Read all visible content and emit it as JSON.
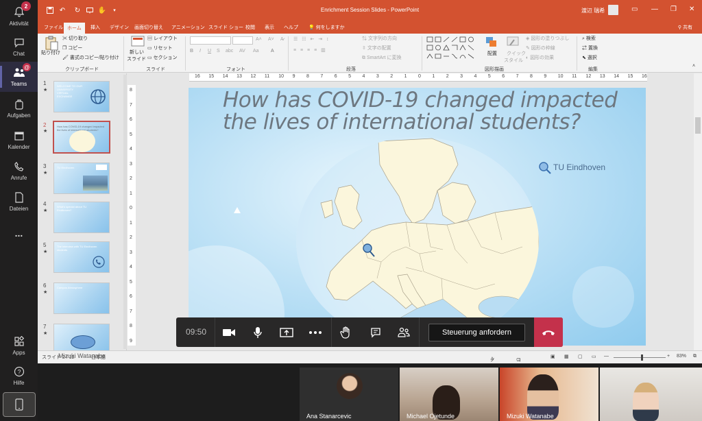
{
  "rail": {
    "items": [
      {
        "label": "Aktivität",
        "badge": "2"
      },
      {
        "label": "Chat"
      },
      {
        "label": "Teams",
        "badge": "@"
      },
      {
        "label": "Aufgaben"
      },
      {
        "label": "Kalender"
      },
      {
        "label": "Anrufe"
      },
      {
        "label": "Dateien"
      },
      {
        "label": "..."
      },
      {
        "label": "Apps"
      },
      {
        "label": "Hilfe"
      }
    ]
  },
  "ppt": {
    "window_title": "Enrichment Session Slides  -  PowerPoint",
    "user": "渡辺 瑞希",
    "tabs": [
      "ファイル",
      "ホーム",
      "挿入",
      "デザイン",
      "画面切り替え",
      "アニメーション",
      "スライド ショー",
      "校閲",
      "表示",
      "ヘルプ",
      "何をしますか"
    ],
    "share": "共有",
    "ribbon": {
      "clipboard": {
        "paste": "貼り付け",
        "cut": "切り取り",
        "copy": "コピー",
        "format_painter": "書式のコピー/貼り付け",
        "group": "クリップボード"
      },
      "slides": {
        "new": "新しい",
        "new2": "スライド",
        "layout": "レイアウト",
        "reset": "リセット",
        "section": "セクション",
        "group": "スライド"
      },
      "font": {
        "group": "フォント"
      },
      "paragraph": {
        "dir": "文字列の方向",
        "align": "文字の配置",
        "smartart": "SmartArt に変換",
        "group": "段落"
      },
      "drawing": {
        "arrange": "配置",
        "quick_style": "クイック",
        "quick_style2": "スタイル",
        "fill": "図形の塗りつぶし",
        "outline": "図形の枠線",
        "effects": "図形の効果",
        "group": "図形描画"
      },
      "editing": {
        "find": "検索",
        "replace": "置換",
        "select": "選択",
        "group": "編集"
      }
    },
    "ruler_h": [
      "16",
      "15",
      "14",
      "13",
      "12",
      "11",
      "10",
      "9",
      "8",
      "7",
      "6",
      "5",
      "4",
      "3",
      "2",
      "1",
      "0",
      "1",
      "2",
      "3",
      "4",
      "5",
      "6",
      "7",
      "8",
      "9",
      "10",
      "11",
      "12",
      "13",
      "14",
      "15",
      "16"
    ],
    "ruler_v": [
      "8",
      "7",
      "6",
      "5",
      "4",
      "3",
      "2",
      "1",
      "0",
      "1",
      "2",
      "3",
      "4",
      "5",
      "6",
      "7",
      "8",
      "9"
    ],
    "thumbnails": [
      {
        "num": "1",
        "caption": "WELCOME TO OUR UNIVERSITY VIRTUAL EXCHANGE"
      },
      {
        "num": "2",
        "caption": "How has COVID-19 changed impacted the lives of international students?"
      },
      {
        "num": "3",
        "caption": "TU Eindhoven"
      },
      {
        "num": "4",
        "caption": "What's special about TU Eindhoven?"
      },
      {
        "num": "5",
        "caption": "The interview with TU Eindhoven students"
      },
      {
        "num": "6",
        "caption": "Campus Atmosphere"
      },
      {
        "num": "7",
        "caption": ""
      }
    ],
    "slide": {
      "title": "How has COVID-19 changed impacted the lives of international students?",
      "location_label": "TU Eindhoven"
    },
    "status": {
      "slide_info": "スライド 2 / 12",
      "lang": "日本語",
      "notes": "ノート",
      "comments": "コメント",
      "zoom": "83%"
    },
    "overlay_name": "Mizuki Watanabe"
  },
  "meeting": {
    "timer": "09:50",
    "request_control": "Steuerung anfordern"
  },
  "gallery": [
    {
      "name": "Ana Stanarcevic"
    },
    {
      "name": "Michael Ojetunde"
    },
    {
      "name": "Mizuki Watanabe"
    },
    {
      "name": ""
    }
  ],
  "colors": {
    "ppt_accent": "#d35230",
    "teams_accent": "#6264a7",
    "hangup": "#c4314b"
  }
}
